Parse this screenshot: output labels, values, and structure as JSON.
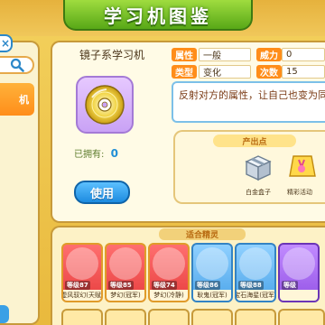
{
  "header": {
    "title": "学习机图鉴"
  },
  "left_panel": {
    "close_label": "×",
    "selected_label": "机"
  },
  "item": {
    "name": "镜子系学习机",
    "owned_label": "已拥有:",
    "owned_count": "0",
    "use_label": "使用",
    "attributes": [
      {
        "label": "属性",
        "value": "一般"
      },
      {
        "label": "威力",
        "value": "0"
      },
      {
        "label": "类型",
        "value": "变化"
      },
      {
        "label": "次数",
        "value": "15"
      }
    ],
    "description": "反射对方的属性，让自己也变为同"
  },
  "output": {
    "title": "产出点",
    "sources": [
      {
        "label": "白金盒子",
        "icon": "platinum-box-icon"
      },
      {
        "label": "精彩活动",
        "icon": "event-icon"
      }
    ]
  },
  "recommended": {
    "title": "适合精灵",
    "cards": [
      {
        "level": "等级87",
        "name": "虚风驭幻(天赋)",
        "color": "red"
      },
      {
        "level": "等级85",
        "name": "梦幻(冠军)",
        "color": "red"
      },
      {
        "level": "等级74",
        "name": "梦幻(冷静)",
        "color": "red"
      },
      {
        "level": "等级86",
        "name": "耿鬼(冠军)",
        "color": "blue"
      },
      {
        "level": "等级88",
        "name": "宝石海星(冠军)",
        "color": "blue"
      },
      {
        "level": "等级",
        "name": "",
        "color": "purple"
      }
    ]
  },
  "colors": {
    "header_green": "#58a817",
    "accent_orange": "#ff8d1a",
    "use_blue": "#1d8be0",
    "owned_blue": "#1f8ed6"
  }
}
